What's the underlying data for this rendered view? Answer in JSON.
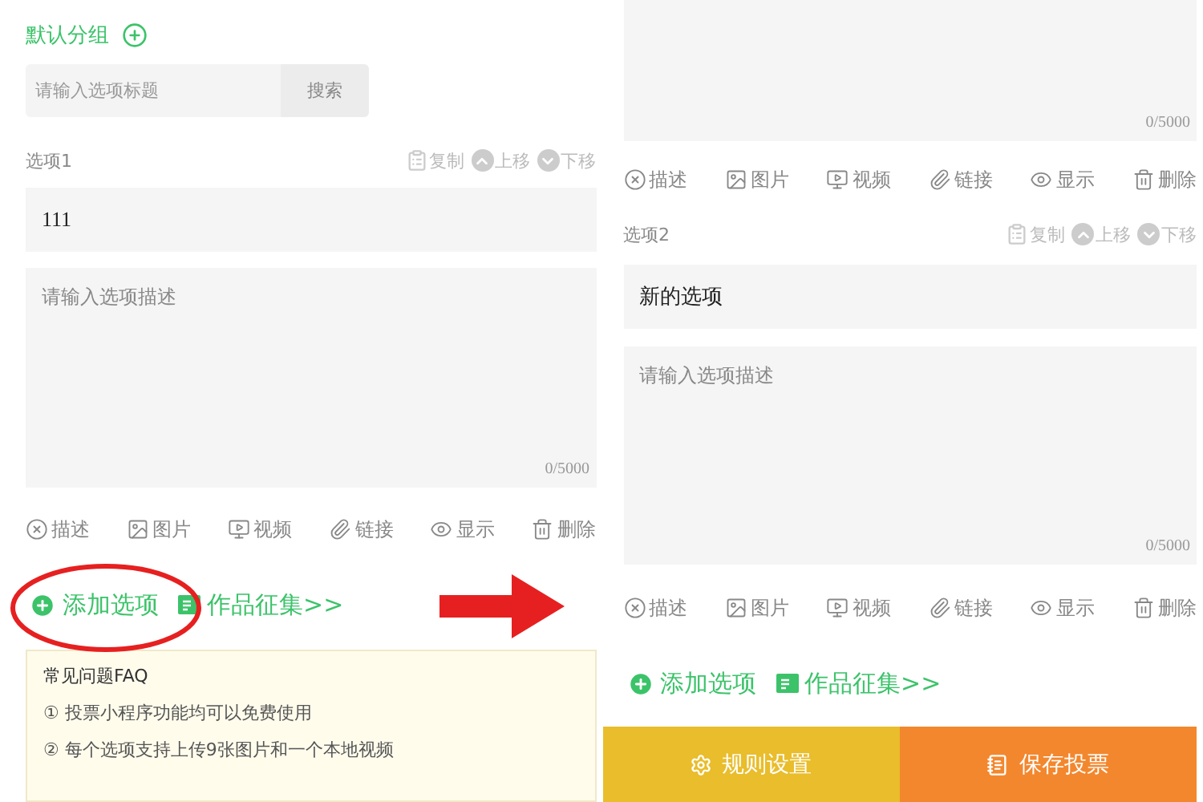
{
  "left_panel": {
    "group": {
      "title": "默认分组"
    },
    "search": {
      "placeholder": "请输入选项标题",
      "button": "搜索"
    },
    "options": [
      {
        "label": "选项1",
        "actions": [
          {
            "kind": "copy",
            "label": "复制"
          },
          {
            "kind": "up",
            "label": "上移"
          },
          {
            "kind": "down",
            "label": "下移"
          }
        ],
        "title": "111",
        "description_placeholder": "请输入选项描述",
        "counter": "0/5000",
        "tools": [
          {
            "kind": "describe",
            "label": "描述"
          },
          {
            "kind": "image",
            "label": "图片"
          },
          {
            "kind": "video",
            "label": "视频"
          },
          {
            "kind": "link",
            "label": "链接"
          },
          {
            "kind": "show",
            "label": "显示"
          },
          {
            "kind": "delete",
            "label": "删除"
          }
        ]
      }
    ],
    "add_option": "添加选项",
    "collect_works": "作品征集>>",
    "faq": {
      "title": "常见问题FAQ",
      "items": [
        "① 投票小程序功能均可以免费使用",
        "② 每个选项支持上传9张图片和一个本地视频"
      ]
    }
  },
  "right_panel": {
    "partial_option": {
      "counter": "0/5000",
      "tools": [
        {
          "kind": "describe",
          "label": "描述"
        },
        {
          "kind": "image",
          "label": "图片"
        },
        {
          "kind": "video",
          "label": "视频"
        },
        {
          "kind": "link",
          "label": "链接"
        },
        {
          "kind": "show",
          "label": "显示"
        },
        {
          "kind": "delete",
          "label": "删除"
        }
      ]
    },
    "options": [
      {
        "label": "选项2",
        "actions": [
          {
            "kind": "copy",
            "label": "复制"
          },
          {
            "kind": "up",
            "label": "上移"
          },
          {
            "kind": "down",
            "label": "下移"
          }
        ],
        "title": "新的选项",
        "description_placeholder": "请输入选项描述",
        "counter": "0/5000",
        "tools": [
          {
            "kind": "describe",
            "label": "描述"
          },
          {
            "kind": "image",
            "label": "图片"
          },
          {
            "kind": "video",
            "label": "视频"
          },
          {
            "kind": "link",
            "label": "链接"
          },
          {
            "kind": "show",
            "label": "显示"
          },
          {
            "kind": "delete",
            "label": "删除"
          }
        ]
      }
    ],
    "add_option": "添加选项",
    "collect_works": "作品征集>>",
    "footer": [
      {
        "kind": "rules",
        "label": "规则设置"
      },
      {
        "kind": "save",
        "label": "保存投票"
      }
    ]
  }
}
